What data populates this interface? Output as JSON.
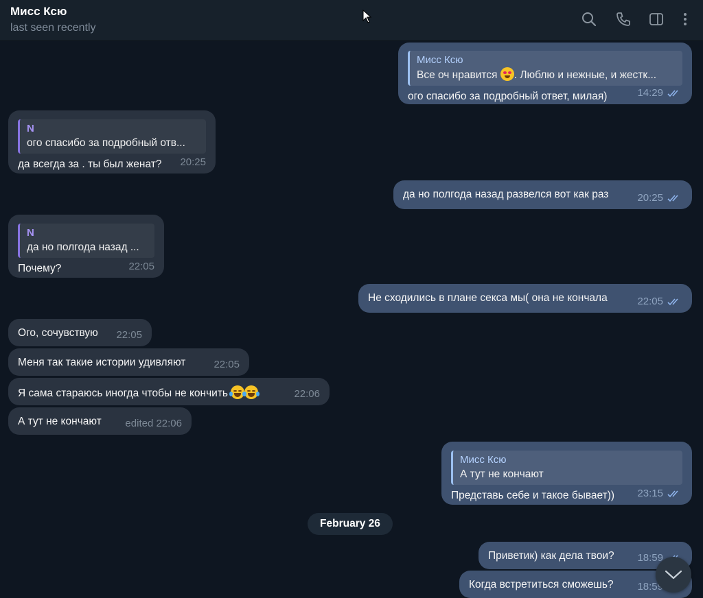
{
  "header": {
    "contact_name": "Мисс Ксю",
    "status": "last seen recently",
    "icons": [
      "search-icon",
      "phone-icon",
      "sidebar-icon",
      "more-vertical-icon"
    ]
  },
  "colors": {
    "background": "#0e1621",
    "header": "#17212b",
    "incoming_bubble": "#2a3340",
    "outgoing_bubble": "#3f5270",
    "reply_accent": "#8774e1"
  },
  "messages": [
    {
      "dir": "out",
      "reply_name": "Мисс Ксю",
      "reply_text": "Все оч нравится",
      "reply_text_after": ". Люблю и нежные, и жестк...",
      "text": "ого спасибо за подробный ответ, милая)",
      "time": "14:29"
    },
    {
      "dir": "in",
      "reply_name": "N",
      "reply_text": "ого спасибо за подробный отв...",
      "text": "да всегда за . ты был женат?",
      "time": "20:25"
    },
    {
      "dir": "out",
      "text": "да но полгода назад развелся вот как раз",
      "time": "20:25"
    },
    {
      "dir": "in",
      "reply_name": "N",
      "reply_text": "да но полгода назад ...",
      "text": "Почему?",
      "time": "22:05"
    },
    {
      "dir": "out",
      "text": "Не сходились в плане секса мы( она не кончала",
      "time": "22:05"
    },
    {
      "dir": "in",
      "text": "Ого, сочувствую",
      "time": "22:05"
    },
    {
      "dir": "in",
      "text": "Меня так такие истории удивляют",
      "time": "22:05"
    },
    {
      "dir": "in",
      "text": "Я сама стараюсь иногда чтобы не кончить",
      "time": "22:06"
    },
    {
      "dir": "in",
      "text": "А тут не кончают",
      "time": "edited 22:06"
    },
    {
      "dir": "out",
      "reply_name": "Мисс Ксю",
      "reply_text": "А тут не кончают",
      "text": "Представь себе и такое бывает))",
      "time": "23:15"
    },
    {
      "dir": "out",
      "text": "Приветик) как дела твои?",
      "time": "18:59"
    },
    {
      "dir": "out",
      "text": "Когда встретиться сможешь?",
      "time": "18:59"
    }
  ],
  "date_separator": "February 26"
}
